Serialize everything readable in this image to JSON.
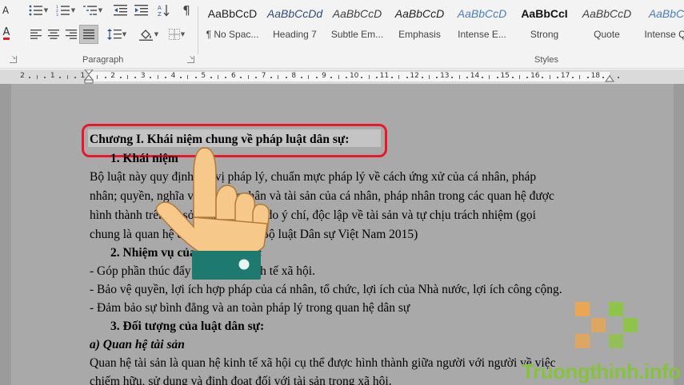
{
  "ribbon": {
    "paragraph_group_label": "Paragraph",
    "styles_group_label": "Styles",
    "styles": [
      {
        "sample": "AaBbCcD",
        "name": "¶ No Spac...",
        "color": "#222222",
        "weight": "normal",
        "italic": false
      },
      {
        "sample": "AaBbCcDd",
        "name": "Heading 7",
        "color": "#2e4d7b",
        "weight": "normal",
        "italic": true
      },
      {
        "sample": "AaBbCcD",
        "name": "Subtle Em...",
        "color": "#404040",
        "weight": "normal",
        "italic": true
      },
      {
        "sample": "AaBbCcD",
        "name": "Emphasis",
        "color": "#222222",
        "weight": "normal",
        "italic": true
      },
      {
        "sample": "AaBbCcD",
        "name": "Intense E...",
        "color": "#4a7ebb",
        "weight": "normal",
        "italic": true
      },
      {
        "sample": "AaBbCcI",
        "name": "Strong",
        "color": "#111111",
        "weight": "bold",
        "italic": false
      },
      {
        "sample": "AaBbCcD",
        "name": "Quote",
        "color": "#404040",
        "weight": "normal",
        "italic": true
      },
      {
        "sample": "AaBbCc",
        "name": "Intense Q...",
        "color": "#4a7ebb",
        "weight": "normal",
        "italic": true
      }
    ]
  },
  "ruler": {
    "numbers": [
      "2",
      "1",
      "1",
      "2",
      "3",
      "4",
      "5",
      "6",
      "7",
      "8",
      "9",
      "10",
      "11",
      "12",
      "13",
      "14",
      "15",
      "16",
      "17",
      "18"
    ]
  },
  "document": {
    "heading": "Chương I. Khái niệm chung về pháp luật dân sự:",
    "lines": [
      "1.    Khái niệm",
      "Bộ luật này quy định địa vị pháp lý, chuẩn mực pháp lý về cách ứng xử của cá nhân, pháp",
      "nhân; quyền, nghĩa vụ về nhân thân và tài sản của cá nhân, pháp nhân trong các quan hệ được",
      "hình thành trên cơ sở bình đẳng, tự do ý chí, độc lập về tài sản và tự chịu trách nhiệm (gọi",
      "chung là quan hệ dân sự) - Điều 1 Bộ luật Dân sự Việt Nam 2015)",
      "2.    Nhiệm vụ của luật dân sự:",
      "- Góp phần thúc đẩy phát triển kinh tế xã hội.",
      "- Bảo vệ quyền, lợi ích hợp pháp của cá nhân, tổ chức, lợi ích của Nhà nước, lợi ích công cộng.",
      "- Đảm bảo sự bình đẳng và an toàn pháp lý trong quan hệ dân sự",
      "3.    Đối tượng của luật dân sự:",
      "a) Quan hệ tài sản",
      "Quan hệ tài sản là quan hệ kinh tế xã hội cụ thể được hình thành giữa người với người về việc",
      "chiếm hữu, sử dụng và định đoạt đối với tài sản trong xã hội."
    ]
  },
  "watermark": {
    "text": "Truongthinh.info",
    "color": "#86c23e"
  },
  "colors": {
    "highlight_box": "#e8172d",
    "hand_skin": "#f6c98a",
    "hand_cuff": "#1e7a6e"
  }
}
